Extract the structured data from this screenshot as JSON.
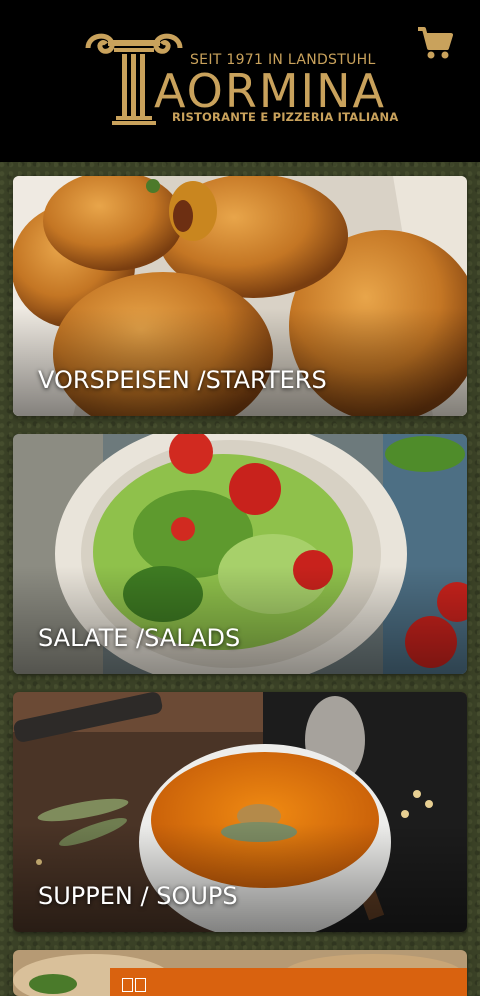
{
  "header": {
    "logo": {
      "tagline": "SEIT 1971 IN LANDSTUHL",
      "name": "AORMINA",
      "subtitle": "RISTORANTE E PIZZERIA ITALIANA"
    },
    "cart_icon": "shopping-cart-icon"
  },
  "categories": [
    {
      "label": "VORSPEISEN /STARTERS"
    },
    {
      "label": "SALATE /SALADS"
    },
    {
      "label": "SUPPEN / SOUPS"
    }
  ],
  "colors": {
    "header_bg": "#000000",
    "gold": "#c9a25c",
    "page_bg": "#3a4126",
    "bar_orange": "#d9620f"
  }
}
